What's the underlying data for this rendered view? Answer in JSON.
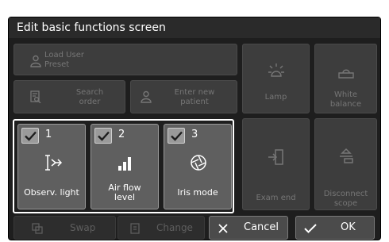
{
  "title": "Edit basic functions screen",
  "tiles": {
    "load_user_preset": "Load User\nPreset",
    "search_order": "Search\norder",
    "enter_new_patient": "Enter new\npatient",
    "lamp": "Lamp",
    "white_balance": "White\nbalance",
    "exam_end": "Exam end",
    "disconnect_scope": "Disconnect\nscope"
  },
  "functions": [
    {
      "number": "1",
      "label": "Observ. light",
      "icon": "observation-light-icon",
      "checked": true
    },
    {
      "number": "2",
      "label": "Air flow\nlevel",
      "icon": "air-flow-level-icon",
      "checked": true
    },
    {
      "number": "3",
      "label": "Iris mode",
      "icon": "iris-mode-icon",
      "checked": true
    }
  ],
  "buttons": {
    "swap": "Swap",
    "change": "Change",
    "cancel": "Cancel",
    "ok": "OK"
  }
}
